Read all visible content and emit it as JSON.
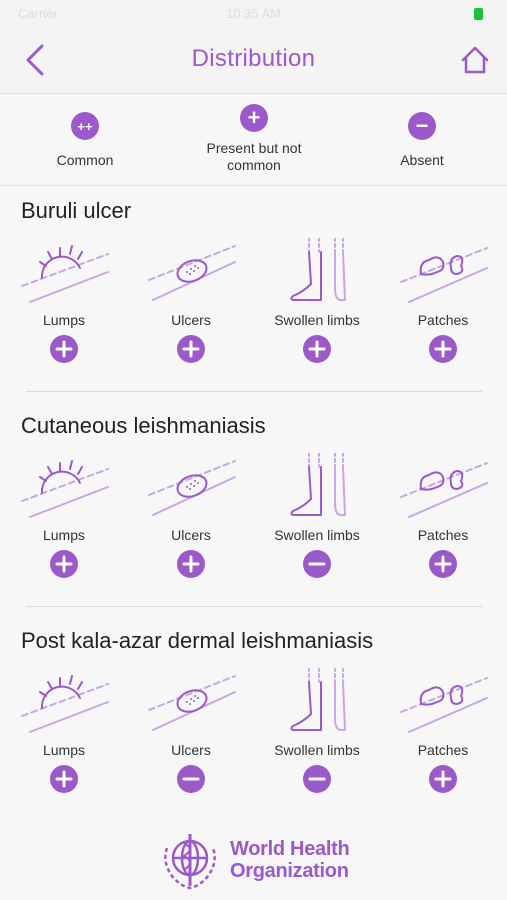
{
  "status_bar": {
    "carrier": "Carrier",
    "time": "10:35 AM"
  },
  "header": {
    "title": "Distribution"
  },
  "legend": [
    {
      "symbol": "++",
      "label": "Common"
    },
    {
      "symbol": "+",
      "label": "Present but not common"
    },
    {
      "symbol": "−",
      "label": "Absent"
    }
  ],
  "symptom_labels": [
    "Lumps",
    "Ulcers",
    "Swollen limbs",
    "Patches"
  ],
  "sections": [
    {
      "title": "Buruli ulcer",
      "statuses": [
        "present",
        "present",
        "present",
        "present"
      ]
    },
    {
      "title": "Cutaneous leishmaniasis",
      "statuses": [
        "present",
        "present",
        "absent",
        "present"
      ]
    },
    {
      "title": "Post kala-azar dermal leishmaniasis",
      "statuses": [
        "present",
        "absent",
        "absent",
        "present"
      ]
    }
  ],
  "footer": {
    "logo_line1": "World Health",
    "logo_line2": "Organization"
  },
  "colors": {
    "accent": "#9b59c9",
    "illustration": "#c9a6e4"
  }
}
